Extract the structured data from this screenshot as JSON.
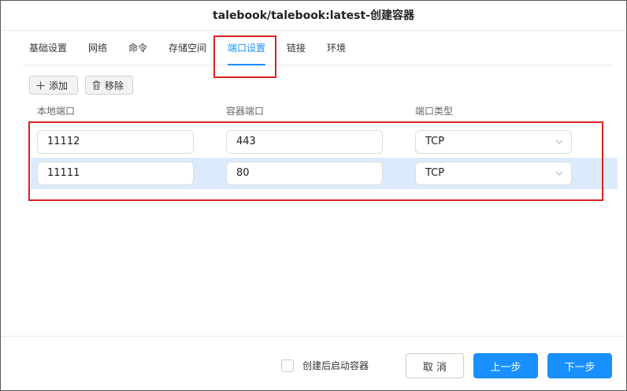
{
  "dialog": {
    "title": "talebook/talebook:latest-创建容器"
  },
  "tabs": [
    {
      "label": "基础设置"
    },
    {
      "label": "网络"
    },
    {
      "label": "命令"
    },
    {
      "label": "存储空间"
    },
    {
      "label": "端口设置",
      "active": true
    },
    {
      "label": "链接"
    },
    {
      "label": "环境"
    }
  ],
  "toolbar": {
    "add_label": "添加",
    "remove_label": "移除"
  },
  "table": {
    "headers": {
      "local_port": "本地端口",
      "container_port": "容器端口",
      "port_type": "端口类型"
    },
    "rows": [
      {
        "local_port": "11112",
        "container_port": "443",
        "port_type": "TCP",
        "selected": false
      },
      {
        "local_port": "11111",
        "container_port": "80",
        "port_type": "TCP",
        "selected": true
      }
    ]
  },
  "footer": {
    "start_after_create_label": "创建后启动容器",
    "start_after_create_checked": false,
    "cancel_label": "取 消",
    "prev_label": "上一步",
    "next_label": "下一步"
  },
  "colors": {
    "accent": "#1890ff",
    "highlight_box": "#e02020",
    "selected_row": "#dcebfb"
  }
}
